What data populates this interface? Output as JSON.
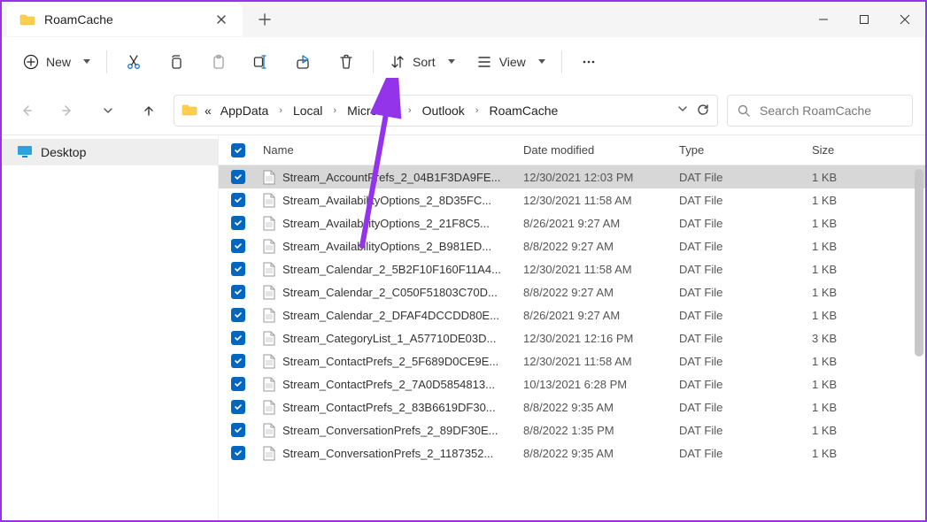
{
  "window": {
    "title": "RoamCache"
  },
  "toolbar": {
    "new_label": "New",
    "sort_label": "Sort",
    "view_label": "View"
  },
  "breadcrumb": {
    "items": [
      "AppData",
      "Local",
      "Microsoft",
      "Outlook",
      "RoamCache"
    ]
  },
  "search": {
    "placeholder": "Search RoamCache"
  },
  "sidebar": {
    "items": [
      {
        "label": "Desktop"
      }
    ]
  },
  "columns": {
    "name": "Name",
    "date": "Date modified",
    "type": "Type",
    "size": "Size"
  },
  "files": [
    {
      "name": "Stream_AccountPrefs_2_04B1F3DA9FE...",
      "date": "12/30/2021 12:03 PM",
      "type": "DAT File",
      "size": "1 KB",
      "selected": true
    },
    {
      "name": "Stream_AvailabilityOptions_2_8D35FC...",
      "date": "12/30/2021 11:58 AM",
      "type": "DAT File",
      "size": "1 KB",
      "selected": false
    },
    {
      "name": "Stream_AvailabilityOptions_2_21F8C5...",
      "date": "8/26/2021 9:27 AM",
      "type": "DAT File",
      "size": "1 KB",
      "selected": false
    },
    {
      "name": "Stream_AvailabilityOptions_2_B981ED...",
      "date": "8/8/2022 9:27 AM",
      "type": "DAT File",
      "size": "1 KB",
      "selected": false
    },
    {
      "name": "Stream_Calendar_2_5B2F10F160F11A4...",
      "date": "12/30/2021 11:58 AM",
      "type": "DAT File",
      "size": "1 KB",
      "selected": false
    },
    {
      "name": "Stream_Calendar_2_C050F51803C70D...",
      "date": "8/8/2022 9:27 AM",
      "type": "DAT File",
      "size": "1 KB",
      "selected": false
    },
    {
      "name": "Stream_Calendar_2_DFAF4DCCDD80E...",
      "date": "8/26/2021 9:27 AM",
      "type": "DAT File",
      "size": "1 KB",
      "selected": false
    },
    {
      "name": "Stream_CategoryList_1_A57710DE03D...",
      "date": "12/30/2021 12:16 PM",
      "type": "DAT File",
      "size": "3 KB",
      "selected": false
    },
    {
      "name": "Stream_ContactPrefs_2_5F689D0CE9E...",
      "date": "12/30/2021 11:58 AM",
      "type": "DAT File",
      "size": "1 KB",
      "selected": false
    },
    {
      "name": "Stream_ContactPrefs_2_7A0D5854813...",
      "date": "10/13/2021 6:28 PM",
      "type": "DAT File",
      "size": "1 KB",
      "selected": false
    },
    {
      "name": "Stream_ContactPrefs_2_83B6619DF30...",
      "date": "8/8/2022 9:35 AM",
      "type": "DAT File",
      "size": "1 KB",
      "selected": false
    },
    {
      "name": "Stream_ConversationPrefs_2_89DF30E...",
      "date": "8/8/2022 1:35 PM",
      "type": "DAT File",
      "size": "1 KB",
      "selected": false
    },
    {
      "name": "Stream_ConversationPrefs_2_1187352...",
      "date": "8/8/2022 9:35 AM",
      "type": "DAT File",
      "size": "1 KB",
      "selected": false
    }
  ]
}
